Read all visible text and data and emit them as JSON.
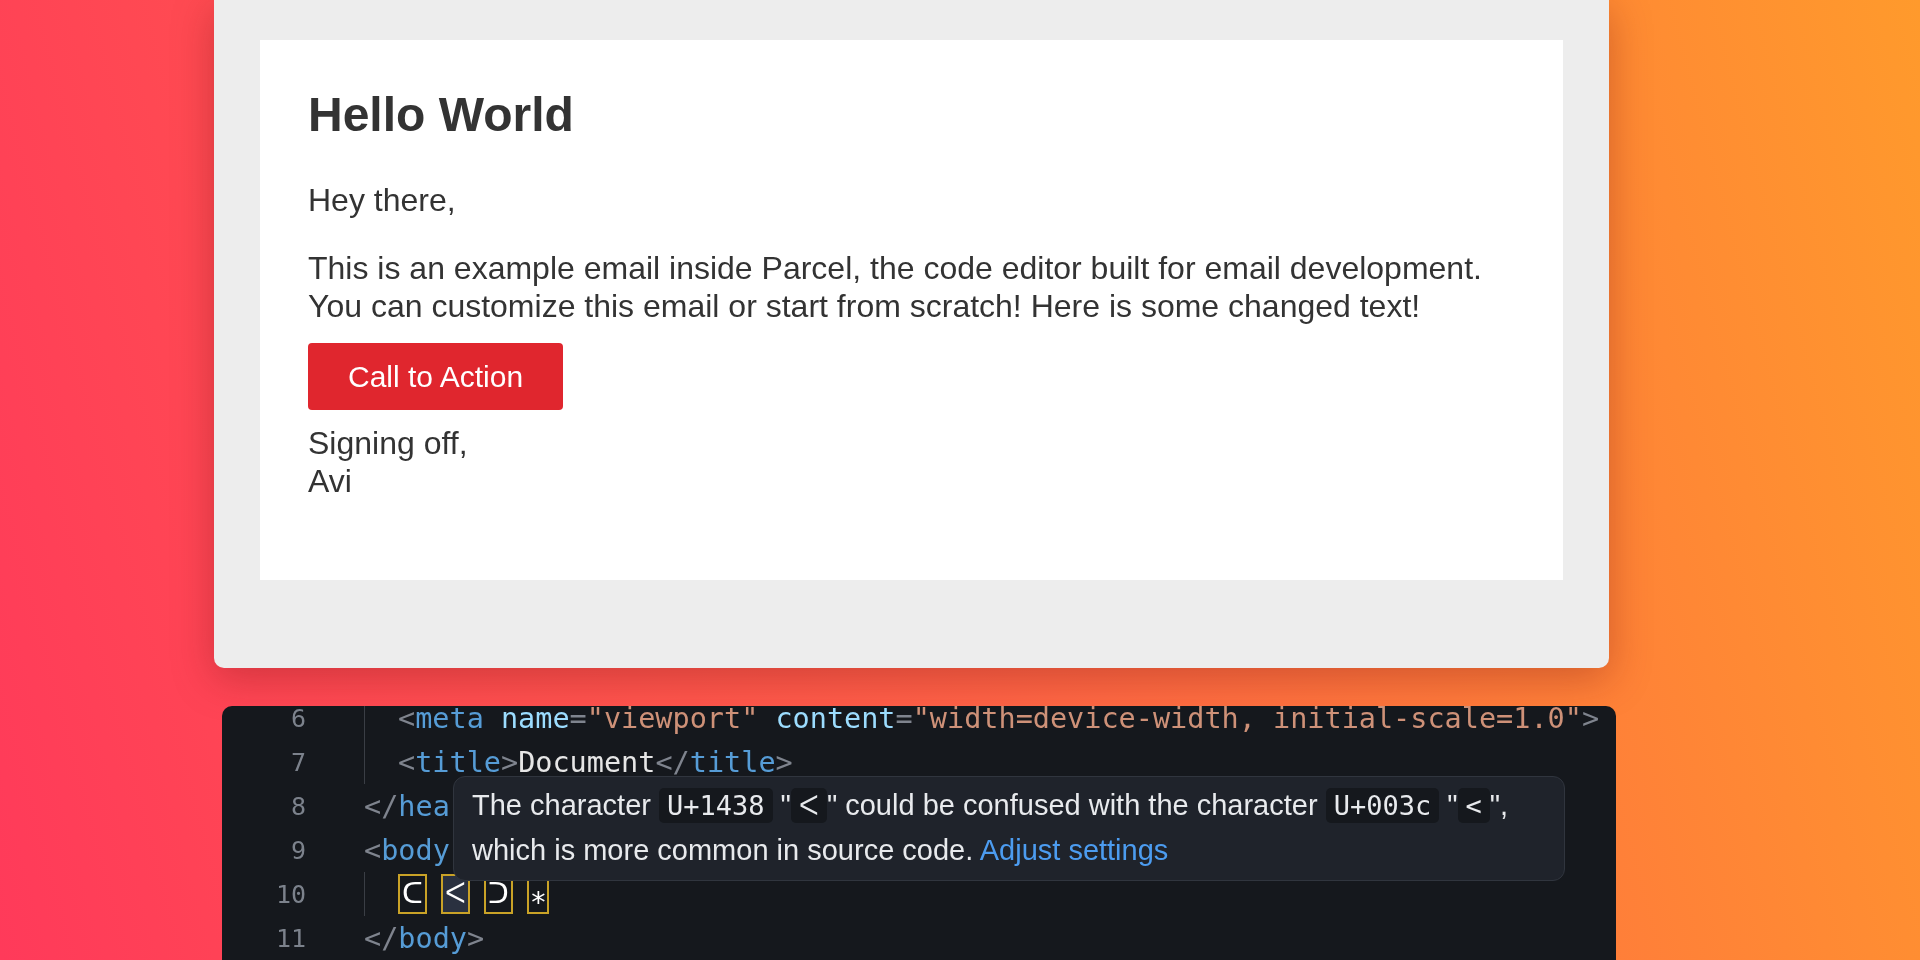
{
  "preview": {
    "heading": "Hello World",
    "greeting": "Hey there,",
    "paragraph": [
      "This is an example email inside Parcel, the code editor built for email development.",
      "You can customize this email or start from scratch! Here is some changed text!"
    ],
    "button": "Call to Action",
    "signoff": [
      "Signing off,",
      "Avi"
    ]
  },
  "editor": {
    "lines": [
      {
        "children": [
          {
            "number": "6",
            "tokens": [
              {
                "kind": "punct",
                "text": "<"
              },
              {
                "kind": "tag",
                "text": "meta"
              },
              {
                "kind": "attr",
                "text": "name"
              },
              {
                "kind": "punct",
                "text": "="
              },
              {
                "kind": "string",
                "text": "\"viewport\""
              },
              {
                "kind": "attr",
                "text": "content"
              },
              {
                "kind": "punct",
                "text": "="
              },
              {
                "kind": "string",
                "text": "\"width=device-width, initial-scale=1.0\""
              },
              {
                "kind": "punct",
                "text": ">"
              }
            ]
          },
          {
            "number": "7",
            "tokens": [
              {
                "kind": "punct",
                "text": "<"
              },
              {
                "kind": "tag",
                "text": "title"
              },
              {
                "kind": "punct",
                "text": ">"
              },
              {
                "kind": "plain",
                "text": "Document"
              },
              {
                "kind": "punct",
                "text": "</"
              },
              {
                "kind": "tag",
                "text": "title"
              },
              {
                "kind": "punct",
                "text": ">"
              }
            ]
          }
        ]
      },
      {
        "number": "8",
        "tokens": [
          {
            "kind": "punct",
            "text": "</"
          },
          {
            "kind": "tag",
            "text": "hea"
          }
        ]
      },
      {
        "number": "9",
        "tokens": [
          {
            "kind": "punct",
            "text": "<"
          },
          {
            "kind": "tag",
            "text": "body"
          }
        ],
        "children": [
          {
            "number": "10",
            "tokens": [
              {
                "kind": "flagged",
                "text": "ᑕ",
                "selected": false
              },
              {
                "kind": "flagged",
                "text": "ᐸ",
                "selected": true
              },
              {
                "kind": "flagged",
                "text": "ᑐ",
                "selected": false
              },
              {
                "kind": "flagged",
                "text": "⁎",
                "selected": false
              }
            ]
          }
        ]
      },
      {
        "number": "11",
        "tokens": [
          {
            "kind": "punct",
            "text": "</"
          },
          {
            "kind": "tag",
            "text": "body"
          },
          {
            "kind": "punct",
            "text": ">"
          }
        ]
      }
    ],
    "tooltip": {
      "parts": [
        {
          "kind": "text",
          "text": "The character "
        },
        {
          "kind": "code",
          "text": "U+1438"
        },
        {
          "kind": "text",
          "text": " \""
        },
        {
          "kind": "code",
          "text": "ᐸ"
        },
        {
          "kind": "text",
          "text": "\" could be confused with the character "
        },
        {
          "kind": "code",
          "text": "U+003c"
        },
        {
          "kind": "text",
          "text": " \""
        },
        {
          "kind": "code",
          "text": "<"
        },
        {
          "kind": "text",
          "text": "\", which is more common in source code. "
        },
        {
          "kind": "link",
          "text": "Adjust settings"
        }
      ]
    }
  }
}
